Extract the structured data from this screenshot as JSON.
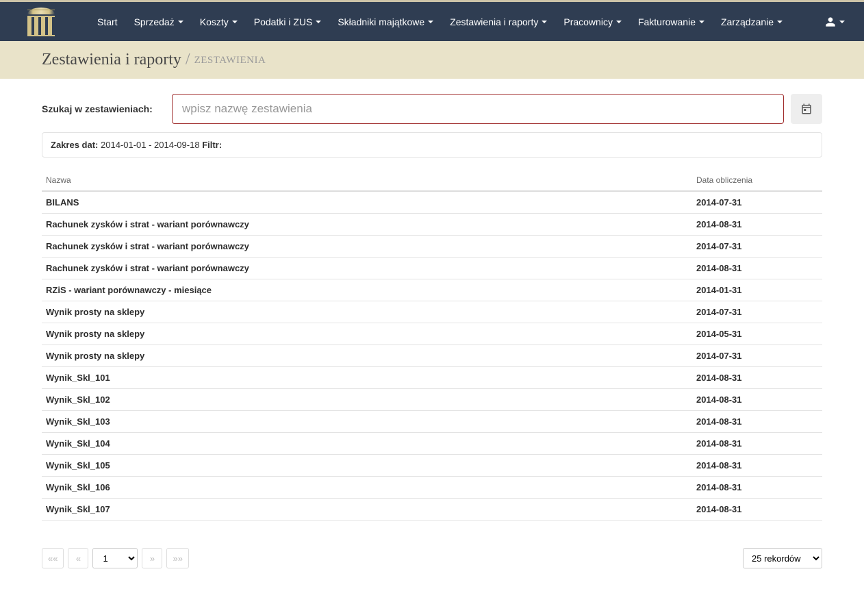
{
  "nav": {
    "items": [
      {
        "label": "Start",
        "caret": false
      },
      {
        "label": "Sprzedaż",
        "caret": true
      },
      {
        "label": "Koszty",
        "caret": true
      },
      {
        "label": "Podatki i ZUS",
        "caret": true
      },
      {
        "label": "Składniki majątkowe",
        "caret": true
      },
      {
        "label": "Zestawienia i raporty",
        "caret": true
      },
      {
        "label": "Pracownicy",
        "caret": true
      },
      {
        "label": "Fakturowanie",
        "caret": true
      },
      {
        "label": "Zarządzanie",
        "caret": true
      }
    ]
  },
  "header": {
    "title": "Zestawienia i raporty",
    "slash": "/",
    "sub": "ZESTAWIENIA"
  },
  "search": {
    "label": "Szukaj w zestawieniach:",
    "placeholder": "wpisz nazwę zestawienia",
    "value": ""
  },
  "filter": {
    "range_label": "Zakres dat:",
    "range_value": "2014-01-01 - 2014-09-18",
    "filter_label": "Filtr:",
    "filter_value": ""
  },
  "table": {
    "col_name": "Nazwa",
    "col_date": "Data obliczenia",
    "rows": [
      {
        "name": "BILANS",
        "date": "2014-07-31"
      },
      {
        "name": "Rachunek zysków i strat - wariant porównawczy",
        "date": "2014-08-31"
      },
      {
        "name": "Rachunek zysków i strat - wariant porównawczy",
        "date": "2014-07-31"
      },
      {
        "name": "Rachunek zysków i strat - wariant porównawczy",
        "date": "2014-08-31"
      },
      {
        "name": "RZiS - wariant porównawczy - miesiące",
        "date": "2014-01-31"
      },
      {
        "name": "Wynik prosty na sklepy",
        "date": "2014-07-31"
      },
      {
        "name": "Wynik prosty na sklepy",
        "date": "2014-05-31"
      },
      {
        "name": "Wynik prosty na sklepy",
        "date": "2014-07-31"
      },
      {
        "name": "Wynik_Skl_101",
        "date": "2014-08-31"
      },
      {
        "name": "Wynik_Skl_102",
        "date": "2014-08-31"
      },
      {
        "name": "Wynik_Skl_103",
        "date": "2014-08-31"
      },
      {
        "name": "Wynik_Skl_104",
        "date": "2014-08-31"
      },
      {
        "name": "Wynik_Skl_105",
        "date": "2014-08-31"
      },
      {
        "name": "Wynik_Skl_106",
        "date": "2014-08-31"
      },
      {
        "name": "Wynik_Skl_107",
        "date": "2014-08-31"
      }
    ]
  },
  "pagination": {
    "first": "««",
    "prev": "«",
    "page": "1",
    "next": "»",
    "last": "»»",
    "records_label": "25 rekordów"
  }
}
